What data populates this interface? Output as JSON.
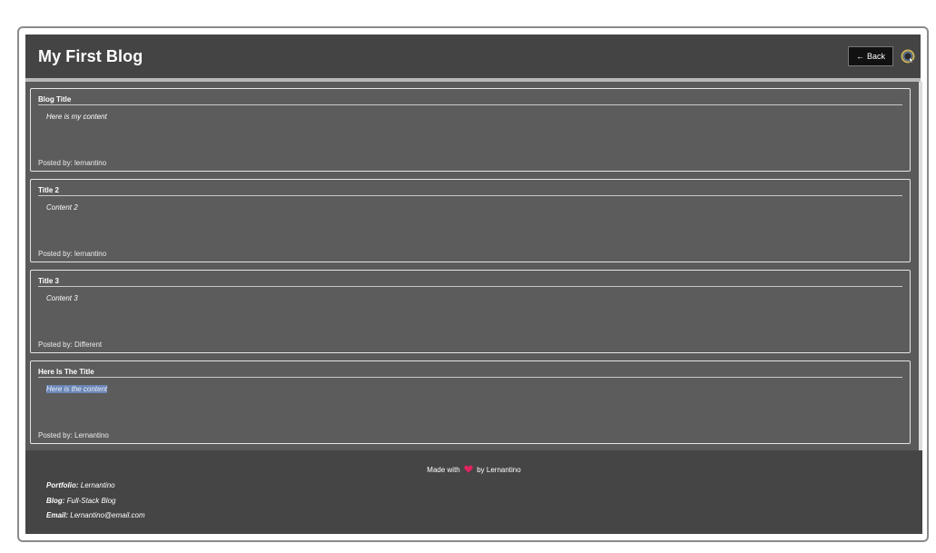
{
  "header": {
    "title": "My First Blog",
    "back_arrow": "←",
    "back_label": "Back",
    "logout_icon": "logout-icon"
  },
  "posts": [
    {
      "title": "Blog Title",
      "content": "Here is my content",
      "posted_by": "Posted by: lernantino"
    },
    {
      "title": "Title 2",
      "content": "Content 2",
      "posted_by": "Posted by: lernantino"
    },
    {
      "title": "Title 3",
      "content": "Content 3",
      "posted_by": "Posted by: Different"
    },
    {
      "title": "Here Is The Title",
      "content": "Here is the content",
      "posted_by": "Posted by: Lernantino"
    }
  ],
  "footer": {
    "made_with_prefix": "Made with",
    "made_with_suffix": "by Lernantino",
    "portfolio_label": "Portfolio:",
    "portfolio_value": "Lernantino",
    "blog_label": "Blog:",
    "blog_value": "Full-Stack Blog",
    "email_label": "Email:",
    "email_value": "Lernantino@email.com"
  },
  "colors": {
    "header_bg": "#444444",
    "main_bg": "#5a5a5a",
    "footer_bg": "#454545",
    "heart": "#e0245e",
    "selection": "#6b86b5"
  }
}
